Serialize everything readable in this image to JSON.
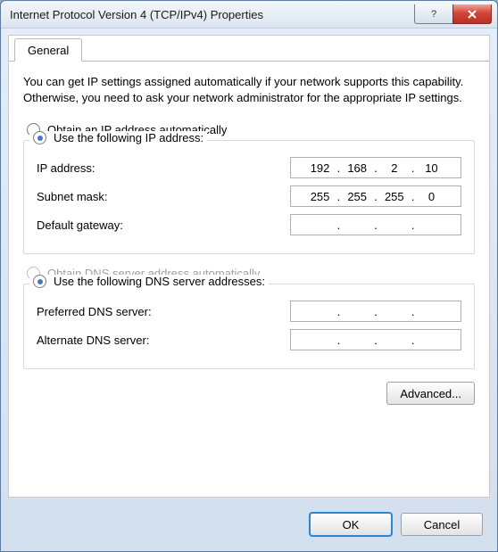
{
  "window": {
    "title": "Internet Protocol Version 4 (TCP/IPv4) Properties"
  },
  "tab": {
    "label": "General"
  },
  "description": "You can get IP settings assigned automatically if your network supports this capability. Otherwise, you need to ask your network administrator for the appropriate IP settings.",
  "radios": {
    "auto_ip": "Obtain an IP address automatically",
    "manual_ip": "Use the following IP address:",
    "auto_dns": "Obtain DNS server address automatically",
    "manual_dns": "Use the following DNS server addresses:"
  },
  "labels": {
    "ip": "IP address:",
    "subnet": "Subnet mask:",
    "gateway": "Default gateway:",
    "pref_dns": "Preferred DNS server:",
    "alt_dns": "Alternate DNS server:"
  },
  "values": {
    "ip": [
      "192",
      "168",
      "2",
      "10"
    ],
    "subnet": [
      "255",
      "255",
      "255",
      "0"
    ],
    "gateway": [
      "",
      "",
      "",
      ""
    ],
    "pref_dns": [
      "",
      "",
      "",
      ""
    ],
    "alt_dns": [
      "",
      "",
      "",
      ""
    ]
  },
  "buttons": {
    "advanced": "Advanced...",
    "ok": "OK",
    "cancel": "Cancel"
  },
  "selection": {
    "ip_mode": "manual",
    "dns_mode": "manual",
    "auto_dns_enabled": false
  }
}
